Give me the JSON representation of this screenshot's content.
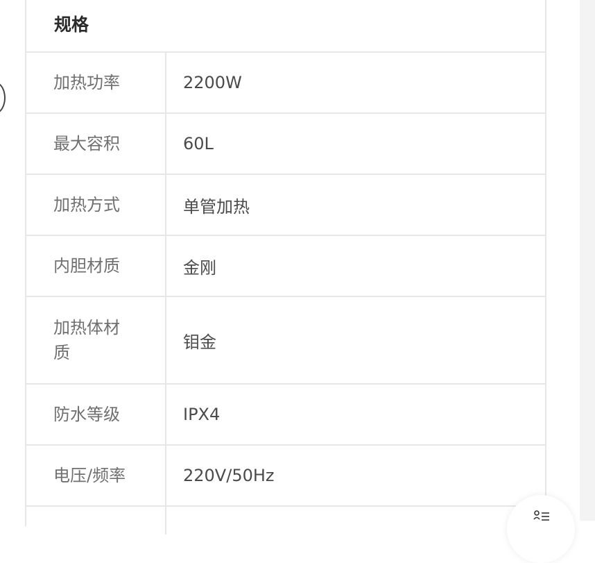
{
  "spec_card": {
    "title": "规格",
    "rows": [
      {
        "label": "加热功率",
        "value": "2200W"
      },
      {
        "label": "最大容积",
        "value": "60L"
      },
      {
        "label": "加热方式",
        "value": "单管加热"
      },
      {
        "label": "内胆材质",
        "value": "金刚"
      },
      {
        "label": "加热体材质",
        "value": "钼金"
      },
      {
        "label": "防水等级",
        "value": "IPX4"
      },
      {
        "label": "电压/频率",
        "value": "220V/50Hz"
      }
    ]
  },
  "floating_button": {
    "icon": "list-icon"
  }
}
